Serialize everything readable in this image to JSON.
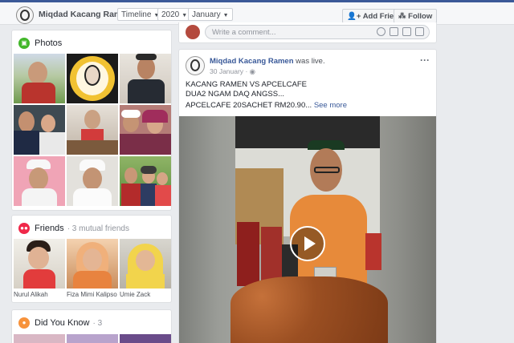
{
  "nav": {
    "name": "Miqdad Kacang Ramen",
    "timeline": "Timeline",
    "year": "2020",
    "month": "January",
    "add_friend": "Add Friend",
    "follow": "Follow"
  },
  "photos": {
    "title": "Photos"
  },
  "friends": {
    "title": "Friends",
    "subtitle": "· 3 mutual friends",
    "names": [
      "Nurul Alikah",
      "Fiza Mimi Kalipso",
      "Umie Zack"
    ]
  },
  "did_you_know": {
    "title": "Did You Know",
    "count": "· 3"
  },
  "comment": {
    "placeholder": "Write a comment..."
  },
  "post": {
    "author": "Miqdad Kacang Ramen",
    "action": "was live.",
    "date": "30 January",
    "line1": "KACANG RAMEN VS APCELCAFE",
    "line2": "DUA2 NGAM DAQ ANGSS...",
    "line3": "APCELCAFE 20SACHET RM20.90...",
    "see_more": "See more",
    "menu": "···"
  },
  "colors": {
    "brand": "#3b5998",
    "link": "#385898",
    "photos_icon": "#42b72a",
    "friends_icon": "#f02849",
    "dyk_icon": "#f7923b"
  },
  "icons": [
    "people-icon",
    "rss-icon",
    "globe-icon",
    "camera-icon",
    "sticker-icon",
    "gif-icon",
    "play-icon"
  ]
}
